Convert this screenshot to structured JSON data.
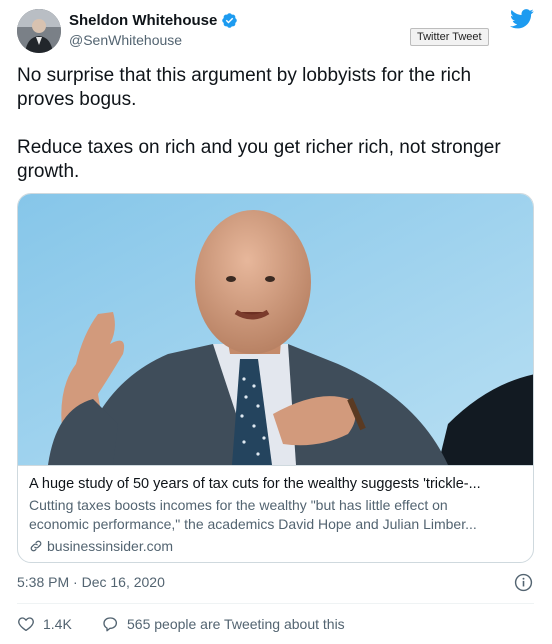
{
  "author": {
    "name": "Sheldon Whitehouse",
    "handle": "@SenWhitehouse",
    "verified": true
  },
  "tooltip": "Twitter Tweet",
  "tweet": {
    "paragraphs": [
      "No surprise that this argument by lobbyists for the rich proves bogus.",
      "Reduce taxes on rich and you get richer rich, not stronger growth."
    ]
  },
  "link_card": {
    "title": "A huge study of 50 years of tax cuts for the wealthy suggests 'trickle-...",
    "description_line1": "Cutting taxes boosts incomes for the wealthy \"but has little effect on",
    "description_line2": "economic performance,\" the academics David Hope and Julian Limber...",
    "domain": "businessinsider.com"
  },
  "timestamp": "5:38 PM · Dec 16, 2020",
  "actions": {
    "likes": "1.4K",
    "reply_text": "565 people are Tweeting about this"
  },
  "colors": {
    "twitter_blue": "#1d9bf0",
    "secondary_text": "#536471",
    "like_red": "#f91880",
    "border": "#cfd9de"
  },
  "icons": [
    "verified-badge-icon",
    "twitter-bird-icon",
    "link-icon",
    "info-icon",
    "heart-icon",
    "speech-bubble-icon"
  ]
}
